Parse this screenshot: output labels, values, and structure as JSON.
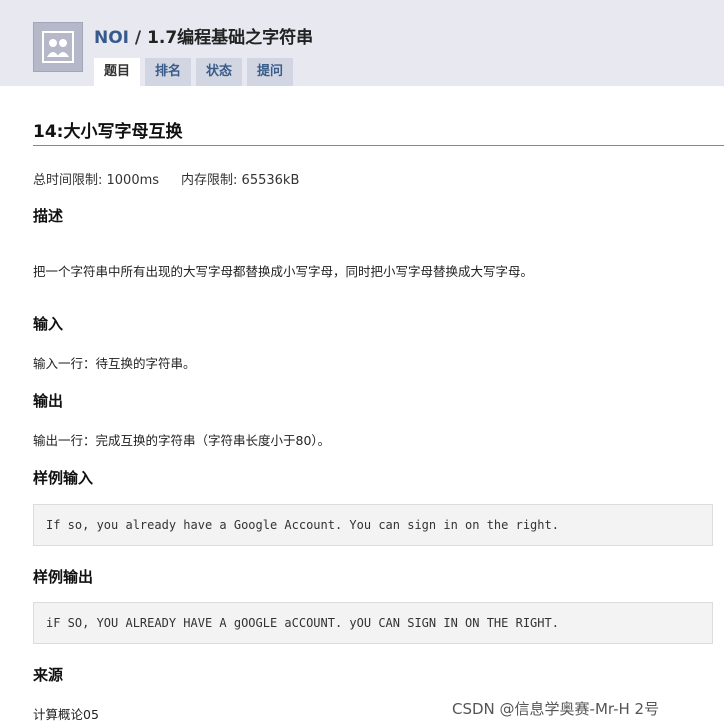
{
  "header": {
    "crumb_root": "NOI",
    "crumb_sep": " / ",
    "crumb_course": "1.7编程基础之字符串",
    "tabs": [
      {
        "label": "题目",
        "active": true
      },
      {
        "label": "排名"
      },
      {
        "label": "状态"
      },
      {
        "label": "提问"
      }
    ]
  },
  "problem": {
    "title": "14:大小写字母互换",
    "time_limit": "总时间限制: 1000ms",
    "memory_limit": "内存限制: 65536kB",
    "description_heading": "描述",
    "description": "把一个字符串中所有出现的大写字母都替换成小写字母，同时把小写字母替换成大写字母。",
    "input_heading": "输入",
    "input": "输入一行：待互换的字符串。",
    "output_heading": "输出",
    "output": "输出一行：完成互换的字符串（字符串长度小于80）。",
    "sample_input_heading": "样例输入",
    "sample_input": "If so, you already have a Google Account. You can sign in on the right.",
    "sample_output_heading": "样例输出",
    "sample_output": "iF SO, YOU ALREADY HAVE A gOOGLE aCCOUNT. yOU CAN SIGN IN ON THE RIGHT.",
    "source_heading": "来源",
    "source": "计算概论05"
  },
  "watermark": "CSDN @信息学奥赛-Mr-H 2号"
}
